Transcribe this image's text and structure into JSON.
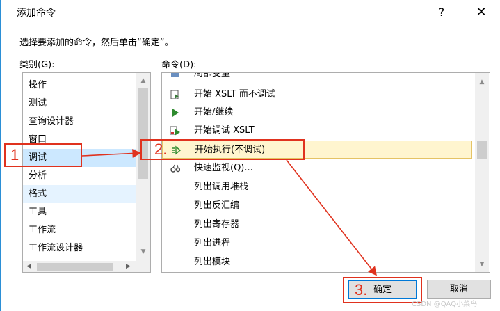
{
  "title": "添加命令",
  "help_symbol": "?",
  "close_symbol": "✕",
  "instruction": "选择要添加的命令，然后单击“确定”。",
  "categories_label": "类别(G):",
  "commands_label": "命令(D):",
  "categories": [
    "操作",
    "测试",
    "查询设计器",
    "窗口",
    "调试",
    "分析",
    "格式",
    "工具",
    "工作流",
    "工作流设计器"
  ],
  "commands": [
    {
      "label": "局部变量",
      "icon": "locals-icon"
    },
    {
      "label": "开始 XSLT 而不调试",
      "icon": "xslt-no-debug-icon"
    },
    {
      "label": "开始/继续",
      "icon": "play-icon"
    },
    {
      "label": "开始调试 XSLT",
      "icon": "xslt-debug-icon"
    },
    {
      "label": "开始执行(不调试)",
      "icon": "start-without-debug-icon"
    },
    {
      "label": "快速监视(Q)...",
      "icon": "quickwatch-icon"
    },
    {
      "label": "列出调用堆栈",
      "icon": ""
    },
    {
      "label": "列出反汇编",
      "icon": ""
    },
    {
      "label": "列出寄存器",
      "icon": ""
    },
    {
      "label": "列出进程",
      "icon": ""
    },
    {
      "label": "列出模块",
      "icon": ""
    }
  ],
  "buttons": {
    "ok": "确定",
    "cancel": "取消"
  },
  "annotations": {
    "step1": "1",
    "step2": "2.",
    "step3": "3."
  },
  "watermark": "CSDN @QAQ小菜鸟",
  "colors": {
    "annotation": "#e0321e",
    "selection": "#cce8ff",
    "highlight": "#fff5cf",
    "accent": "#0078d7"
  }
}
